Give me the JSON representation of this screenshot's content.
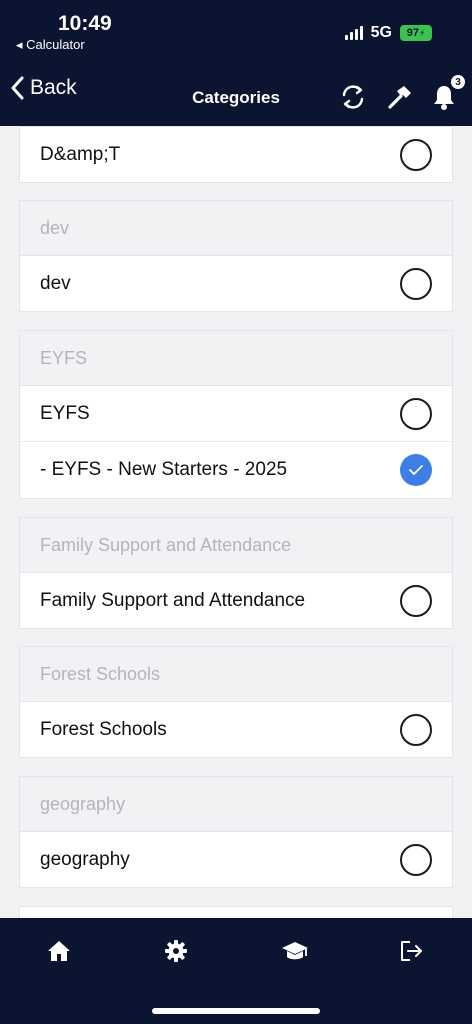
{
  "status_bar": {
    "time": "10:49",
    "back_app": "◂ Calculator",
    "network": "5G",
    "battery": "97",
    "battery_color": "#3cc34d"
  },
  "nav": {
    "back_label": "Back",
    "title": "Categories",
    "notification_count": "3",
    "icons": [
      "sync-icon",
      "hammer-icon",
      "bell-icon"
    ]
  },
  "partial_item": {
    "label": "D&amp;T",
    "checked": false
  },
  "sections": [
    {
      "header": "dev",
      "items": [
        {
          "label": "dev",
          "checked": false
        }
      ]
    },
    {
      "header": "EYFS",
      "items": [
        {
          "label": "EYFS",
          "checked": false
        },
        {
          "label": "- EYFS - New Starters - 2025",
          "checked": true
        }
      ]
    },
    {
      "header": "Family Support and Attendance",
      "items": [
        {
          "label": "Family Support and Attendance",
          "checked": false
        }
      ]
    },
    {
      "header": "Forest Schools",
      "items": [
        {
          "label": "Forest Schools",
          "checked": false
        }
      ]
    },
    {
      "header": "geography",
      "items": [
        {
          "label": "geography",
          "checked": false
        }
      ]
    }
  ],
  "tabs": [
    "home-icon",
    "settings-icon",
    "graduation-cap-icon",
    "logout-icon"
  ],
  "colors": {
    "navy": "#0b1430",
    "accent": "#3d7fe6",
    "header_text": "#b4b4bc"
  }
}
